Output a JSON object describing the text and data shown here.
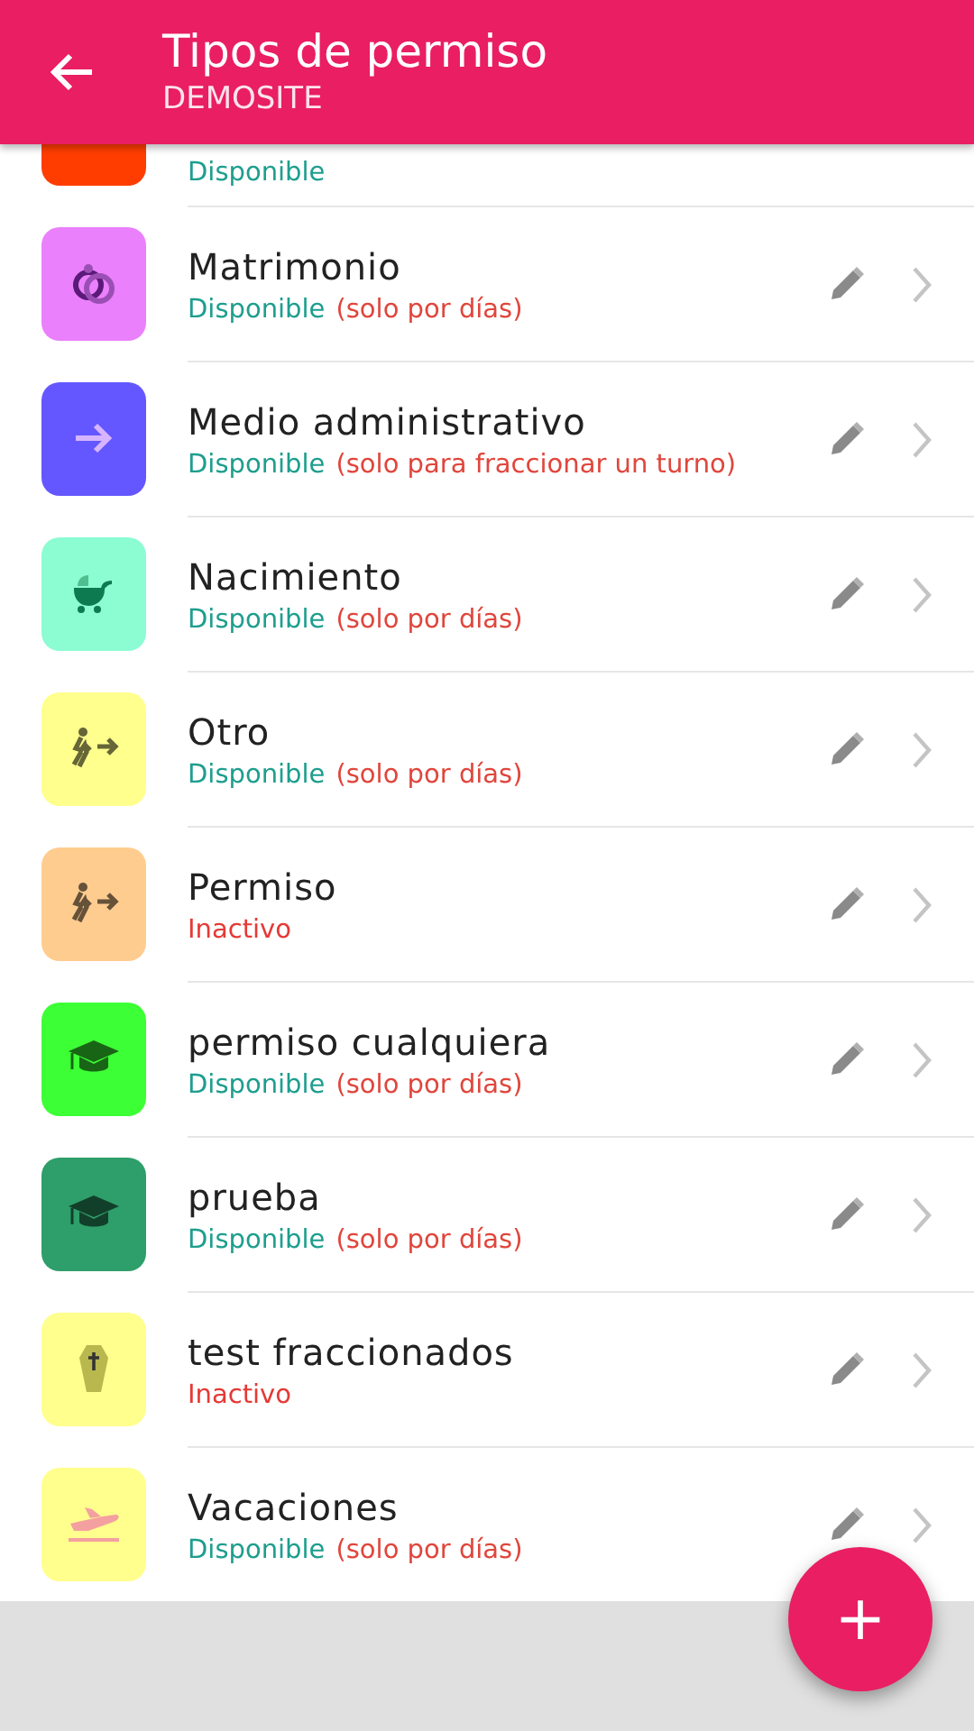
{
  "app_bar": {
    "title": "Tipos de permiso",
    "subtitle": "DEMOSITE"
  },
  "items": [
    {
      "color": "#ff3d00",
      "kind": "none",
      "status": "Disponible",
      "active": true,
      "partial": true
    },
    {
      "name": "Matrimonio",
      "color": "#ea80fc",
      "kind": "rings",
      "status": "Disponible",
      "active": true,
      "note": "(solo por días)"
    },
    {
      "name": "Medio administrativo",
      "color": "#6457ff",
      "kind": "arrow",
      "status": "Disponible",
      "active": true,
      "note": "(solo para fraccionar un turno)"
    },
    {
      "name": "Nacimiento",
      "color": "#8cfcd3",
      "kind": "stroller",
      "status": "Disponible",
      "active": true,
      "note": "(solo por días)"
    },
    {
      "name": "Otro",
      "color": "#ffff8d",
      "kind": "walker",
      "status": "Disponible",
      "active": true,
      "note": "(solo por días)"
    },
    {
      "name": "Permiso",
      "color": "#ffcc8f",
      "kind": "walker",
      "status": "Inactivo",
      "active": false
    },
    {
      "name": "permiso cualquiera",
      "color": "#3dff35",
      "kind": "cap",
      "status": "Disponible",
      "active": true,
      "note": "(solo por días)"
    },
    {
      "name": "prueba",
      "color": "#2e9e6a",
      "kind": "cap",
      "status": "Disponible",
      "active": true,
      "note": "(solo por días)"
    },
    {
      "name": "test fraccionados",
      "color": "#ffff8d",
      "kind": "coffin",
      "status": "Inactivo",
      "active": false
    },
    {
      "name": "Vacaciones",
      "color": "#ffff8d",
      "kind": "plane",
      "status": "Disponible",
      "active": true,
      "note": "(solo por días)"
    }
  ],
  "fab": {
    "label": "+"
  }
}
